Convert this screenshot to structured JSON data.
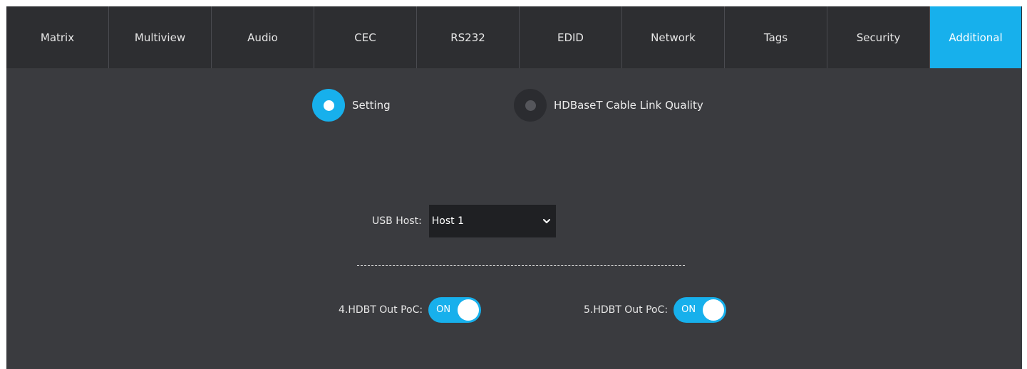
{
  "tabs": [
    {
      "label": "Matrix"
    },
    {
      "label": "Multiview"
    },
    {
      "label": "Audio"
    },
    {
      "label": "CEC"
    },
    {
      "label": "RS232"
    },
    {
      "label": "EDID"
    },
    {
      "label": "Network"
    },
    {
      "label": "Tags"
    },
    {
      "label": "Security"
    },
    {
      "label": "Additional",
      "active": true
    }
  ],
  "mode": {
    "setting_label": "Setting",
    "hdbaset_label": "HDBaseT Cable Link Quality",
    "selected": "Setting"
  },
  "usb": {
    "label": "USB Host:",
    "value": "Host 1"
  },
  "poc": [
    {
      "label": "4.HDBT Out PoC:",
      "state": "ON"
    },
    {
      "label": "5.HDBT Out PoC:",
      "state": "ON"
    }
  ],
  "colors": {
    "accent": "#17b0ec",
    "background": "#3a3b3f",
    "tabbar": "#2d2e31"
  },
  "icons": {
    "select_chevron": "chevron-down-icon"
  }
}
